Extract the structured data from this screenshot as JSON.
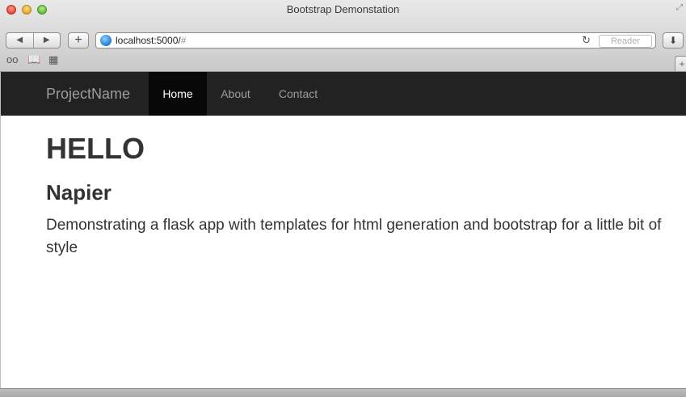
{
  "window": {
    "title": "Bootstrap Demonstation"
  },
  "toolbar": {
    "back_icon": "◀",
    "forward_icon": "▶",
    "add_icon": "+",
    "url_host": "localhost:5000/",
    "url_hash": "#",
    "reload_icon": "↻",
    "reader_label": "Reader",
    "download_icon": "⬇"
  },
  "bookmarks": {
    "reading_list_icon": "oo",
    "bookmarks_icon": "📖",
    "top_sites_icon": "▦",
    "new_tab_icon": "+"
  },
  "navbar": {
    "brand": "ProjectName",
    "items": [
      {
        "label": "Home",
        "active": true
      },
      {
        "label": "About",
        "active": false
      },
      {
        "label": "Contact",
        "active": false
      }
    ]
  },
  "content": {
    "heading": "HELLO",
    "subheading": "Napier",
    "lead": "Demonstrating a flask app with templates for html generation and bootstrap for a little bit of style"
  },
  "colors": {
    "navbar_bg": "#222222",
    "navbar_active_bg": "#080808",
    "navbar_text": "#9d9d9d",
    "navbar_active_text": "#ffffff",
    "body_text": "#333333"
  }
}
